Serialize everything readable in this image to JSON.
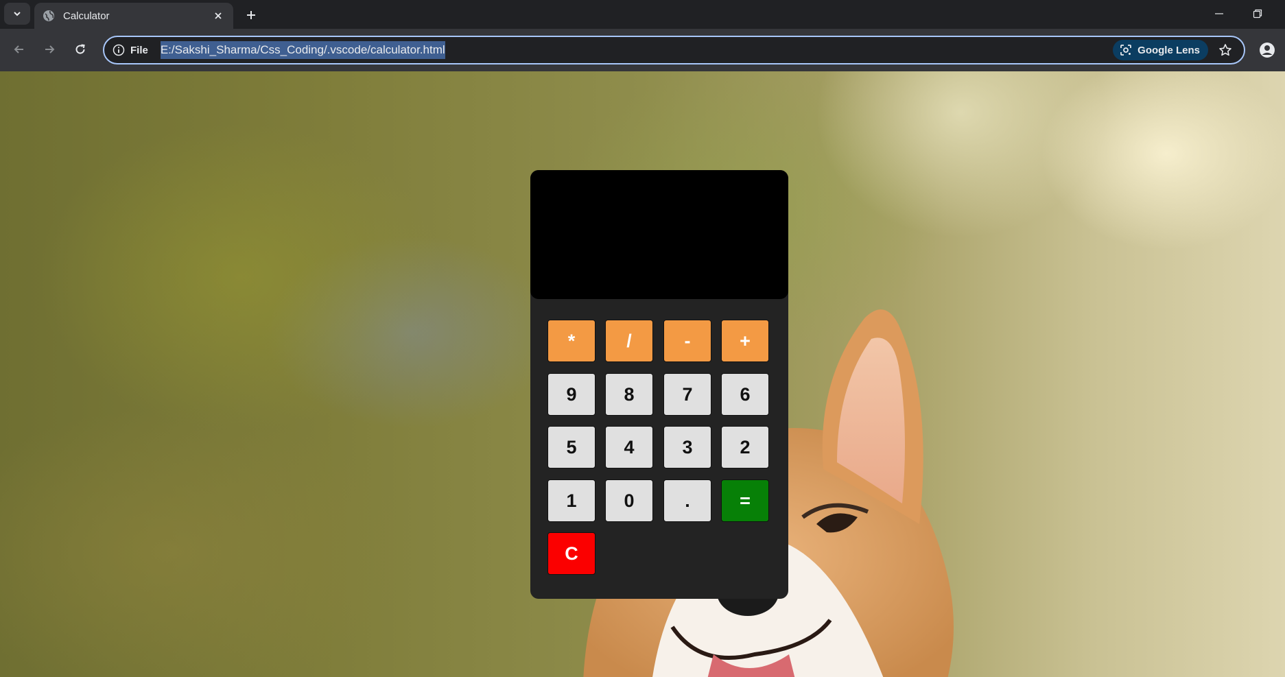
{
  "browser": {
    "tab": {
      "title": "Calculator",
      "favicon": "globe-icon"
    },
    "address_bar": {
      "site_info_label": "File",
      "url": "E:/Sakshi_Sharma/Css_Coding/.vscode/calculator.html",
      "lens_label": "Google Lens"
    },
    "icons": {
      "tab_search": "chevron-down-icon",
      "close_tab": "close-icon",
      "new_tab": "plus-icon",
      "minimize": "minimize-icon",
      "restore": "restore-icon",
      "back": "arrow-left-icon",
      "forward": "arrow-right-icon",
      "reload": "reload-icon",
      "site_info": "info-icon",
      "lens": "lens-icon",
      "bookmark": "star-icon",
      "profile": "profile-icon"
    }
  },
  "calculator": {
    "display_value": "",
    "keys": {
      "multiply": "*",
      "divide": "/",
      "subtract": "-",
      "add": "+",
      "nine": "9",
      "eight": "8",
      "seven": "7",
      "six": "6",
      "five": "5",
      "four": "4",
      "three": "3",
      "two": "2",
      "one": "1",
      "zero": "0",
      "decimal": ".",
      "equals": "=",
      "clear": "C"
    },
    "colors": {
      "body": "#232323",
      "display": "#000000",
      "operator": "#f39a44",
      "digit": "#e0e0e0",
      "equals": "#078007",
      "clear": "#fb0000"
    }
  }
}
